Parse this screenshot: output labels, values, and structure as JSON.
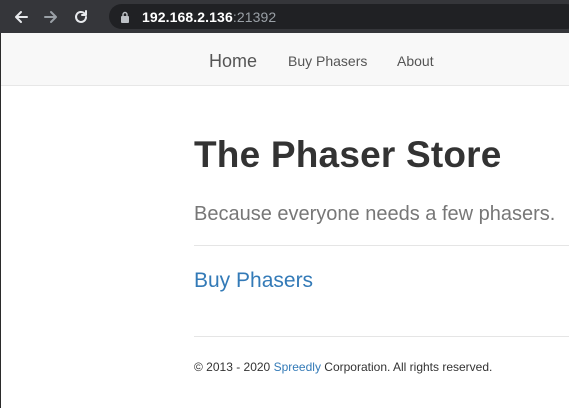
{
  "browser": {
    "url_host": "192.168.2.136",
    "url_port": ":21392",
    "icons": [
      "back-arrow-icon",
      "forward-arrow-icon",
      "reload-icon",
      "lock-icon"
    ]
  },
  "nav": {
    "brand": "Home",
    "links": [
      "Buy Phasers",
      "About"
    ]
  },
  "hero": {
    "title": "The Phaser Store",
    "subtitle": "Because everyone needs a few phasers.",
    "cta": "Buy Phasers"
  },
  "footer": {
    "prefix": "© 2013 - 2020 ",
    "company_link": "Spreedly",
    "suffix": " Corporation. All rights reserved."
  },
  "colors": {
    "chrome_bg": "#35363a",
    "address_bg": "#202124",
    "navbar_bg": "#f8f8f8",
    "link": "#337ab7",
    "title": "#333333",
    "subtitle": "#777777"
  }
}
